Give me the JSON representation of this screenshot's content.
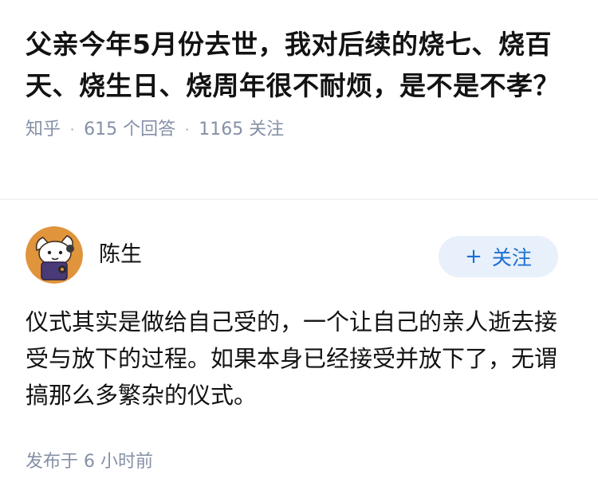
{
  "question": {
    "title": "父亲今年5月份去世，我对后续的烧七、烧百天、烧生日、烧周年很不耐烦，是不是不孝？",
    "source": "知乎",
    "answer_count": "615 个回答",
    "follower_count": "1165 关注",
    "separator": "·"
  },
  "answer": {
    "author": {
      "name": "陈生",
      "avatar_icon": "cartoon-character-avatar"
    },
    "follow_button": {
      "plus": "+",
      "label": "关注"
    },
    "content": "仪式其实是做给自己受的，一个让自己的亲人逝去接受与放下的过程。如果本身已经接受并放下了，无谓搞那么多繁杂的仪式。",
    "published": "发布于  6 小时前"
  },
  "colors": {
    "meta_text": "#8590a6",
    "accent": "#1a6fd1",
    "follow_button_bg": "#e8f0fb",
    "avatar_bg": "#e0943c"
  }
}
